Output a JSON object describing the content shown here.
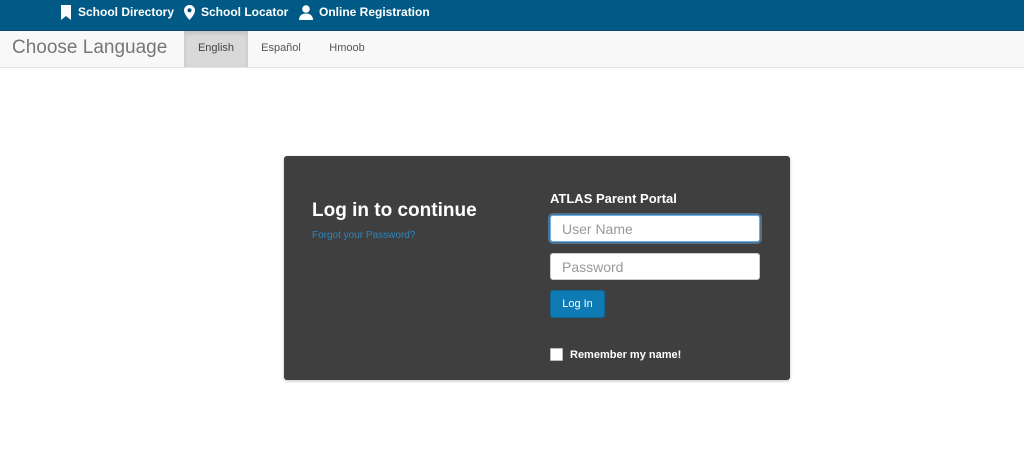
{
  "topnav": {
    "items": [
      {
        "label": "School Directory",
        "icon": "bookmark-icon"
      },
      {
        "label": "School Locator",
        "icon": "map-pin-icon"
      },
      {
        "label": "Online Registration",
        "icon": "user-icon"
      }
    ],
    "background": "#005a85"
  },
  "language_bar": {
    "title": "Choose Language",
    "tabs": [
      {
        "label": "English",
        "selected": true
      },
      {
        "label": "Español",
        "selected": false
      },
      {
        "label": "Hmoob",
        "selected": false
      }
    ]
  },
  "login": {
    "heading": "Log in to continue",
    "forgot_password": "Forgot your Password?",
    "portal_title": "ATLAS Parent Portal",
    "username": {
      "value": "",
      "placeholder": "User Name"
    },
    "password": {
      "value": "",
      "placeholder": "Password"
    },
    "submit_label": "Log In",
    "remember_label": "Remember my name!",
    "remember_checked": false,
    "panel_color": "#3f3f3f",
    "accent_color": "#0e7bb5"
  }
}
